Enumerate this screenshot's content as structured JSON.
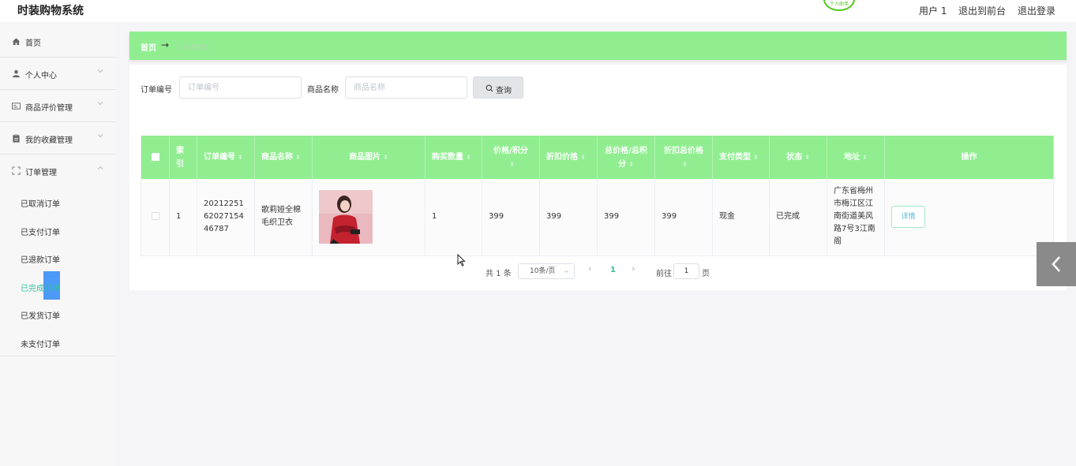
{
  "app": {
    "title": "时装购物系统",
    "badge_text": "个人助手"
  },
  "header": {
    "user_label": "用户 1",
    "back_to_front": "退出到前台",
    "logout": "退出登录"
  },
  "sidebar": {
    "items": [
      {
        "label": "首页",
        "icon": "home-icon"
      },
      {
        "label": "个人中心",
        "icon": "user-icon",
        "expandable": true
      },
      {
        "label": "商品评价管理",
        "icon": "review-icon",
        "expandable": true
      },
      {
        "label": "我的收藏管理",
        "icon": "clipboard-icon",
        "expandable": true
      },
      {
        "label": "订单管理",
        "icon": "order-icon",
        "expandable": true,
        "expanded": true
      }
    ],
    "order_submenu": [
      {
        "label": "已取消订单"
      },
      {
        "label": "已支付订单"
      },
      {
        "label": "已退款订单"
      },
      {
        "label": "已完成订单",
        "active": true
      },
      {
        "label": "已发货订单"
      },
      {
        "label": "未支付订单"
      }
    ]
  },
  "breadcrumb": {
    "home": "首页",
    "separator": "→",
    "current": "订单管理"
  },
  "search": {
    "order_no_label": "订单编号",
    "order_no_placeholder": "订单编号",
    "product_name_label": "商品名称",
    "product_name_placeholder": "商品名称",
    "button_label": "查询"
  },
  "table": {
    "columns": [
      "索引",
      "订单编号",
      "商品名称",
      "商品图片",
      "购买数量",
      "价格/积分",
      "折扣价格",
      "总价格/总积分",
      "折扣总价格",
      "支付类型",
      "状态",
      "地址",
      "操作"
    ],
    "rows": [
      {
        "index": "1",
        "order_no": "202122516202715446787",
        "product_name": "歌莉娅全棉毛织卫衣",
        "quantity": "1",
        "price": "399",
        "discount_price": "399",
        "total_price": "399",
        "discount_total": "399",
        "pay_type": "现金",
        "status": "已完成",
        "address": "广东省梅州市梅江区江南街道美风路7号3江南阁",
        "action_label": "详情"
      }
    ]
  },
  "pagination": {
    "total_text": "共 1 条",
    "page_size": "10条/页",
    "current_page": "1",
    "goto_label": "前往",
    "goto_value": "1",
    "page_suffix": "页"
  },
  "colors": {
    "accent": "#90ee90",
    "active_text": "#2fbfa0",
    "active_marker": "#3a8ef6"
  }
}
